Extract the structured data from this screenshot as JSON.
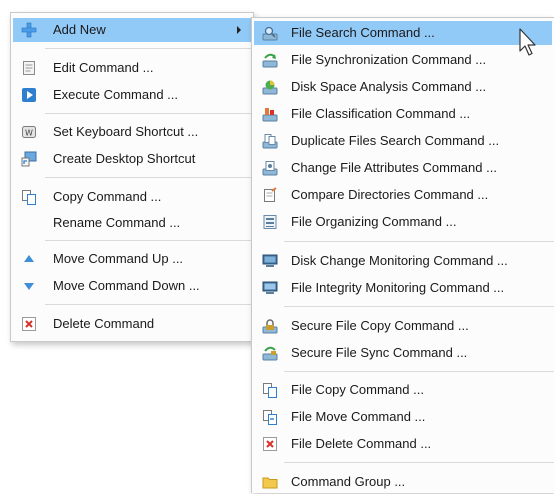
{
  "main_menu": {
    "items": [
      {
        "label": "Add New",
        "icon": "plus-icon"
      },
      {
        "label": "Edit Command ...",
        "icon": "edit-icon"
      },
      {
        "label": "Execute Command ...",
        "icon": "play-icon"
      },
      {
        "label": "Set Keyboard Shortcut ...",
        "icon": "keyboard-icon"
      },
      {
        "label": "Create Desktop Shortcut",
        "icon": "desktop-shortcut-icon"
      },
      {
        "label": "Copy Command ...",
        "icon": "copy-icon"
      },
      {
        "label": "Rename Command ...",
        "icon": ""
      },
      {
        "label": "Move Command Up ...",
        "icon": "arrow-up-icon"
      },
      {
        "label": "Move Command Down ...",
        "icon": "arrow-down-icon"
      },
      {
        "label": "Delete Command",
        "icon": "delete-icon"
      }
    ]
  },
  "sub_menu": {
    "items": [
      {
        "label": "File Search Command ...",
        "icon": "file-search-icon"
      },
      {
        "label": "File Synchronization Command ...",
        "icon": "file-sync-icon"
      },
      {
        "label": "Disk Space Analysis Command ...",
        "icon": "disk-space-icon"
      },
      {
        "label": "File Classification Command ...",
        "icon": "file-classification-icon"
      },
      {
        "label": "Duplicate Files Search Command ...",
        "icon": "duplicate-files-icon"
      },
      {
        "label": "Change File Attributes Command ...",
        "icon": "file-attributes-icon"
      },
      {
        "label": "Compare Directories Command ...",
        "icon": "compare-directories-icon"
      },
      {
        "label": "File Organizing Command ...",
        "icon": "file-organizing-icon"
      },
      {
        "label": "Disk Change Monitoring Command ...",
        "icon": "disk-monitor-icon"
      },
      {
        "label": "File Integrity Monitoring Command ...",
        "icon": "integrity-monitor-icon"
      },
      {
        "label": "Secure File Copy Command ...",
        "icon": "secure-copy-icon"
      },
      {
        "label": "Secure File Sync Command ...",
        "icon": "secure-sync-icon"
      },
      {
        "label": "File Copy Command ...",
        "icon": "file-copy-icon"
      },
      {
        "label": "File Move Command ...",
        "icon": "file-move-icon"
      },
      {
        "label": "File Delete Command ...",
        "icon": "file-delete-icon"
      },
      {
        "label": "Command Group ...",
        "icon": "folder-icon"
      }
    ]
  },
  "colors": {
    "highlight": "#91c9f7",
    "accent_blue": "#2f7fd1",
    "delete_red": "#d9322b",
    "folder_yellow": "#f2c94c"
  }
}
